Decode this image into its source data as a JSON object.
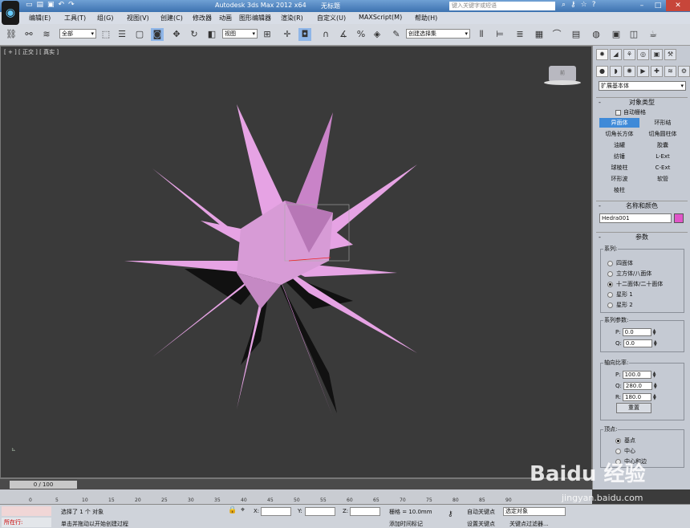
{
  "title_bar": {
    "app_title": "Autodesk 3ds Max  2012 x64",
    "doc_title": "无标题",
    "search_placeholder": "键入关键字或短语",
    "quick_access_icons": [
      "new-icon",
      "open-icon",
      "save-icon",
      "undo-icon",
      "redo-icon"
    ],
    "right_icons": [
      "binoculars-icon",
      "key-icon",
      "star-icon",
      "help-icon"
    ]
  },
  "menu": {
    "items": [
      "编辑(E)",
      "工具(T)",
      "组(G)",
      "视图(V)",
      "创建(C)",
      "修改器",
      "动画",
      "图形编辑器",
      "渲染(R)",
      "自定义(U)",
      "MAXScript(M)",
      "帮助(H)"
    ]
  },
  "toolbar": {
    "selection_filter": "全部",
    "reference_coord": "视图",
    "named_selection": "创建选择集"
  },
  "viewport": {
    "label": "[ + ] [ 正交 ] [ 真实 ]",
    "viewcube_label": "前",
    "object_color": "#e8a0e0"
  },
  "command_panel": {
    "category_dropdown": "扩展基本体",
    "rollout_object_type": "对象类型",
    "autogrid_label": "自动栅格",
    "object_buttons": [
      "异面体",
      "环形结",
      "切角长方体",
      "切角圆柱体",
      "油罐",
      "胶囊",
      "纺锤",
      "L-Ext",
      "球棱柱",
      "C-Ext",
      "环形波",
      "软管",
      "棱柱"
    ],
    "selected_button": "异面体",
    "rollout_name_color": "名称和颜色",
    "object_name": "Hedra001",
    "object_swatch_color": "#e055c8",
    "rollout_params": "参数",
    "family_title": "系列:",
    "family_options": [
      "四面体",
      "立方体/八面体",
      "十二面体/二十面体",
      "星形 1",
      "星形 2"
    ],
    "family_selected": "十二面体/二十面体",
    "family_params_title": "系列参数:",
    "family_params": [
      {
        "label": "P:",
        "value": "0.0"
      },
      {
        "label": "Q:",
        "value": "0.0"
      }
    ],
    "axis_scale_title": "轴向比率:",
    "axis_scale": [
      {
        "label": "P:",
        "value": "100.0"
      },
      {
        "label": "Q:",
        "value": "280.0"
      },
      {
        "label": "R:",
        "value": "180.0"
      }
    ],
    "reset_label": "重置",
    "vertex_title": "顶点:",
    "vertex_options": [
      "基点",
      "中心",
      "中心和边"
    ],
    "vertex_selected": "基点"
  },
  "timeline": {
    "frame_readout": "0 / 100",
    "ticks": [
      "0",
      "5",
      "10",
      "15",
      "20",
      "25",
      "30",
      "35",
      "40",
      "45",
      "50",
      "55",
      "60",
      "65",
      "70",
      "75",
      "80",
      "85",
      "90"
    ]
  },
  "status": {
    "location": "所在行:",
    "selection_msg": "选择了 1 个 对象",
    "prompt_msg": "单击并拖动以开始创建过程",
    "x_label": "X:",
    "y_label": "Y:",
    "z_label": "Z:",
    "grid_label": "栅格 = 10.0mm",
    "add_time_tag": "添加时间标记",
    "auto_key": "自动关键点",
    "set_key": "设置关键点",
    "key_mode_select": "选定对象",
    "key_filters": "关键点过滤器..."
  },
  "watermark": {
    "logo_text": "Baidu 经验",
    "url": "jingyan.baidu.com"
  }
}
